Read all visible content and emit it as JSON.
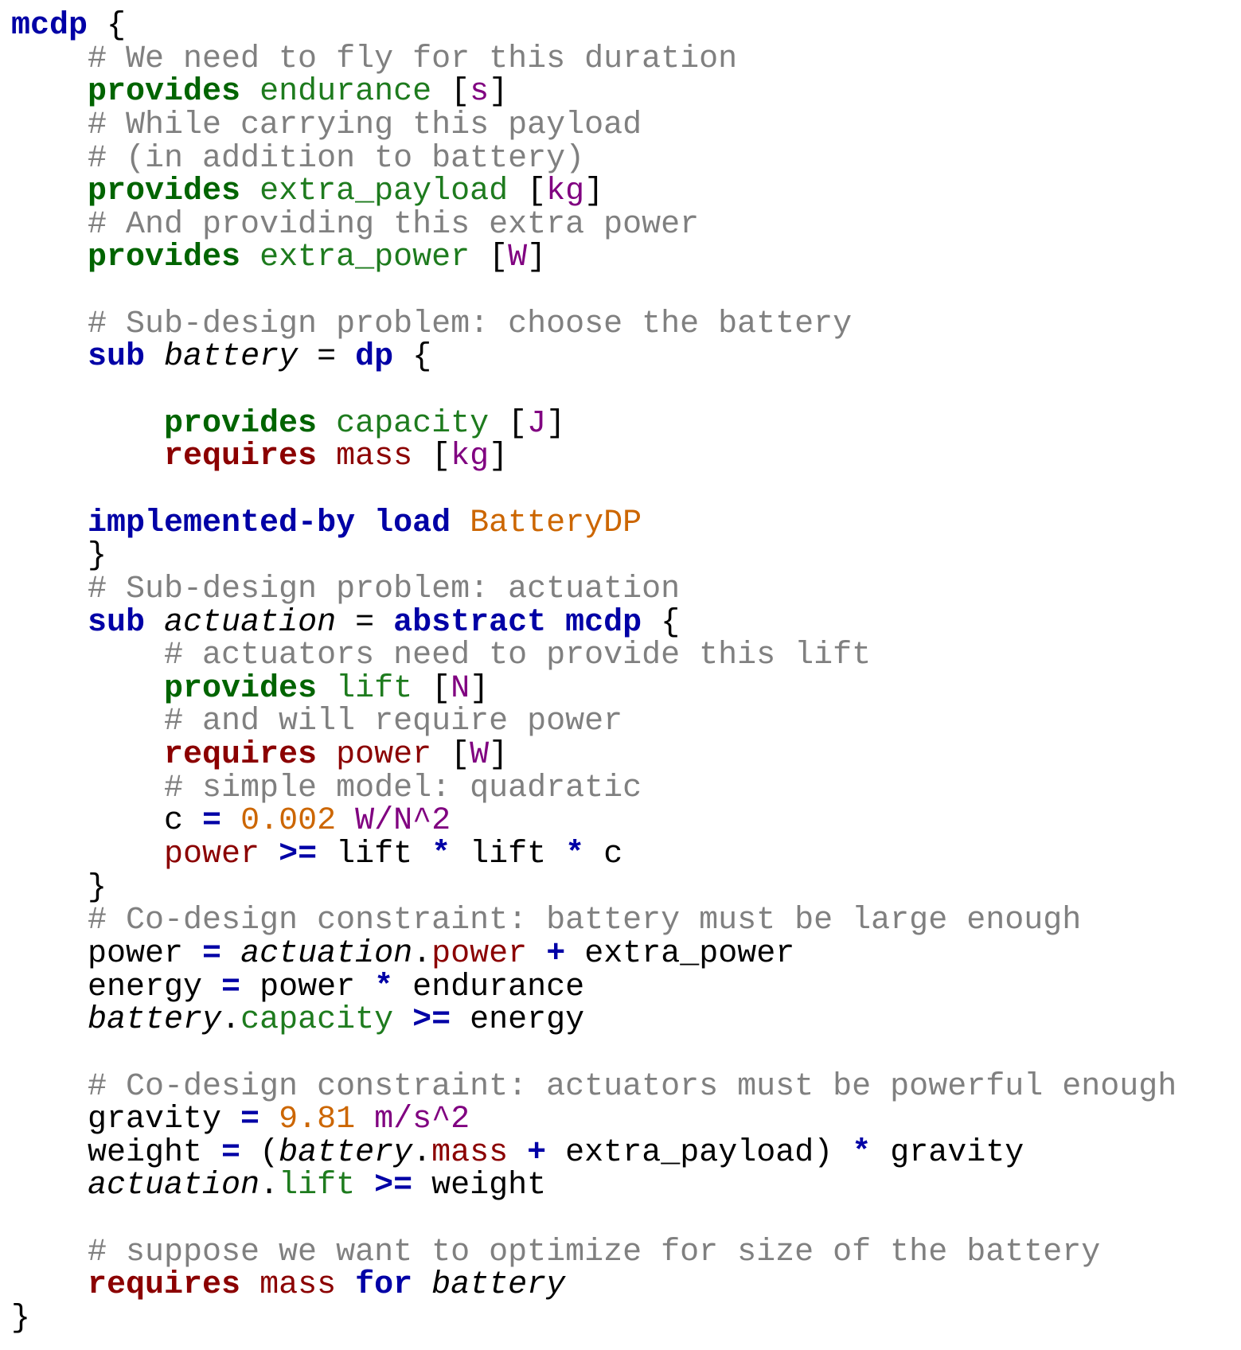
{
  "colors": {
    "keyword_blue": "#0000a6",
    "keyword_green": "#006400",
    "keyword_red": "#8b0000",
    "identifier_green": "#1e7b1e",
    "identifier_red": "#8b0000",
    "unit_purple": "#800080",
    "number_orange": "#cc6600",
    "comment_gray": "#808080",
    "text_black": "#000000"
  },
  "code": {
    "lines": [
      [
        {
          "text": "mcdp",
          "kind": "kw-blue"
        },
        {
          "text": " {",
          "kind": "plain"
        }
      ],
      [
        {
          "text": "    ",
          "kind": "plain"
        },
        {
          "text": "# We need to fly for this duration",
          "kind": "comment"
        }
      ],
      [
        {
          "text": "    ",
          "kind": "plain"
        },
        {
          "text": "provides",
          "kind": "kw-green"
        },
        {
          "text": " ",
          "kind": "plain"
        },
        {
          "text": "endurance",
          "kind": "id-green"
        },
        {
          "text": " [",
          "kind": "plain"
        },
        {
          "text": "s",
          "kind": "unit"
        },
        {
          "text": "]",
          "kind": "plain"
        }
      ],
      [
        {
          "text": "    ",
          "kind": "plain"
        },
        {
          "text": "# While carrying this payload",
          "kind": "comment"
        }
      ],
      [
        {
          "text": "    ",
          "kind": "plain"
        },
        {
          "text": "# (in addition to battery)",
          "kind": "comment"
        }
      ],
      [
        {
          "text": "    ",
          "kind": "plain"
        },
        {
          "text": "provides",
          "kind": "kw-green"
        },
        {
          "text": " ",
          "kind": "plain"
        },
        {
          "text": "extra_payload",
          "kind": "id-green"
        },
        {
          "text": " [",
          "kind": "plain"
        },
        {
          "text": "kg",
          "kind": "unit"
        },
        {
          "text": "]",
          "kind": "plain"
        }
      ],
      [
        {
          "text": "    ",
          "kind": "plain"
        },
        {
          "text": "# And providing this extra power",
          "kind": "comment"
        }
      ],
      [
        {
          "text": "    ",
          "kind": "plain"
        },
        {
          "text": "provides",
          "kind": "kw-green"
        },
        {
          "text": " ",
          "kind": "plain"
        },
        {
          "text": "extra_power",
          "kind": "id-green"
        },
        {
          "text": " [",
          "kind": "plain"
        },
        {
          "text": "W",
          "kind": "unit"
        },
        {
          "text": "]",
          "kind": "plain"
        }
      ],
      [],
      [
        {
          "text": "    ",
          "kind": "plain"
        },
        {
          "text": "# Sub-design problem: choose the battery",
          "kind": "comment"
        }
      ],
      [
        {
          "text": "    ",
          "kind": "plain"
        },
        {
          "text": "sub",
          "kind": "kw-blue"
        },
        {
          "text": " ",
          "kind": "plain"
        },
        {
          "text": "battery",
          "kind": "italic"
        },
        {
          "text": " = ",
          "kind": "plain"
        },
        {
          "text": "dp",
          "kind": "kw-blue"
        },
        {
          "text": " {",
          "kind": "plain"
        }
      ],
      [],
      [
        {
          "text": "        ",
          "kind": "plain"
        },
        {
          "text": "provides",
          "kind": "kw-green"
        },
        {
          "text": " ",
          "kind": "plain"
        },
        {
          "text": "capacity",
          "kind": "id-green"
        },
        {
          "text": " [",
          "kind": "plain"
        },
        {
          "text": "J",
          "kind": "unit"
        },
        {
          "text": "]",
          "kind": "plain"
        }
      ],
      [
        {
          "text": "        ",
          "kind": "plain"
        },
        {
          "text": "requires",
          "kind": "kw-red"
        },
        {
          "text": " ",
          "kind": "plain"
        },
        {
          "text": "mass",
          "kind": "id-red"
        },
        {
          "text": " [",
          "kind": "plain"
        },
        {
          "text": "kg",
          "kind": "unit"
        },
        {
          "text": "]",
          "kind": "plain"
        }
      ],
      [],
      [
        {
          "text": "    ",
          "kind": "plain"
        },
        {
          "text": "implemented-by",
          "kind": "kw-blue"
        },
        {
          "text": " ",
          "kind": "plain"
        },
        {
          "text": "load",
          "kind": "kw-blue"
        },
        {
          "text": " ",
          "kind": "plain"
        },
        {
          "text": "BatteryDP",
          "kind": "number"
        }
      ],
      [
        {
          "text": "    }",
          "kind": "plain"
        }
      ],
      [
        {
          "text": "    ",
          "kind": "plain"
        },
        {
          "text": "# Sub-design problem: actuation",
          "kind": "comment"
        }
      ],
      [
        {
          "text": "    ",
          "kind": "plain"
        },
        {
          "text": "sub",
          "kind": "kw-blue"
        },
        {
          "text": " ",
          "kind": "plain"
        },
        {
          "text": "actuation",
          "kind": "italic"
        },
        {
          "text": " = ",
          "kind": "plain"
        },
        {
          "text": "abstract",
          "kind": "kw-blue"
        },
        {
          "text": " ",
          "kind": "plain"
        },
        {
          "text": "mcdp",
          "kind": "kw-blue"
        },
        {
          "text": " {",
          "kind": "plain"
        }
      ],
      [
        {
          "text": "        ",
          "kind": "plain"
        },
        {
          "text": "# actuators need to provide this lift",
          "kind": "comment"
        }
      ],
      [
        {
          "text": "        ",
          "kind": "plain"
        },
        {
          "text": "provides",
          "kind": "kw-green"
        },
        {
          "text": " ",
          "kind": "plain"
        },
        {
          "text": "lift",
          "kind": "id-green"
        },
        {
          "text": " [",
          "kind": "plain"
        },
        {
          "text": "N",
          "kind": "unit"
        },
        {
          "text": "]",
          "kind": "plain"
        }
      ],
      [
        {
          "text": "        ",
          "kind": "plain"
        },
        {
          "text": "# and will require power",
          "kind": "comment"
        }
      ],
      [
        {
          "text": "        ",
          "kind": "plain"
        },
        {
          "text": "requires",
          "kind": "kw-red"
        },
        {
          "text": " ",
          "kind": "plain"
        },
        {
          "text": "power",
          "kind": "id-red"
        },
        {
          "text": " [",
          "kind": "plain"
        },
        {
          "text": "W",
          "kind": "unit"
        },
        {
          "text": "]",
          "kind": "plain"
        }
      ],
      [
        {
          "text": "        ",
          "kind": "plain"
        },
        {
          "text": "# simple model: quadratic",
          "kind": "comment"
        }
      ],
      [
        {
          "text": "        c ",
          "kind": "plain"
        },
        {
          "text": "=",
          "kind": "op"
        },
        {
          "text": " ",
          "kind": "plain"
        },
        {
          "text": "0.002",
          "kind": "number"
        },
        {
          "text": " ",
          "kind": "plain"
        },
        {
          "text": "W/N^2",
          "kind": "unit"
        }
      ],
      [
        {
          "text": "        ",
          "kind": "plain"
        },
        {
          "text": "power",
          "kind": "id-red"
        },
        {
          "text": " ",
          "kind": "plain"
        },
        {
          "text": ">=",
          "kind": "op"
        },
        {
          "text": " lift ",
          "kind": "plain"
        },
        {
          "text": "*",
          "kind": "op"
        },
        {
          "text": " lift ",
          "kind": "plain"
        },
        {
          "text": "*",
          "kind": "op"
        },
        {
          "text": " c",
          "kind": "plain"
        }
      ],
      [
        {
          "text": "    }",
          "kind": "plain"
        }
      ],
      [
        {
          "text": "    ",
          "kind": "plain"
        },
        {
          "text": "# Co-design constraint: battery must be large enough",
          "kind": "comment"
        }
      ],
      [
        {
          "text": "    power ",
          "kind": "plain"
        },
        {
          "text": "=",
          "kind": "op"
        },
        {
          "text": " ",
          "kind": "plain"
        },
        {
          "text": "actuation",
          "kind": "italic"
        },
        {
          "text": ".",
          "kind": "plain"
        },
        {
          "text": "power",
          "kind": "id-red"
        },
        {
          "text": " ",
          "kind": "plain"
        },
        {
          "text": "+",
          "kind": "op"
        },
        {
          "text": " extra_power",
          "kind": "plain"
        }
      ],
      [
        {
          "text": "    energy ",
          "kind": "plain"
        },
        {
          "text": "=",
          "kind": "op"
        },
        {
          "text": " power ",
          "kind": "plain"
        },
        {
          "text": "*",
          "kind": "op"
        },
        {
          "text": " endurance",
          "kind": "plain"
        }
      ],
      [
        {
          "text": "    ",
          "kind": "plain"
        },
        {
          "text": "battery",
          "kind": "italic"
        },
        {
          "text": ".",
          "kind": "plain"
        },
        {
          "text": "capacity",
          "kind": "id-green"
        },
        {
          "text": " ",
          "kind": "plain"
        },
        {
          "text": ">=",
          "kind": "op"
        },
        {
          "text": " energy",
          "kind": "plain"
        }
      ],
      [],
      [
        {
          "text": "    ",
          "kind": "plain"
        },
        {
          "text": "# Co-design constraint: actuators must be powerful enough",
          "kind": "comment"
        }
      ],
      [
        {
          "text": "    gravity ",
          "kind": "plain"
        },
        {
          "text": "=",
          "kind": "op"
        },
        {
          "text": " ",
          "kind": "plain"
        },
        {
          "text": "9.81",
          "kind": "number"
        },
        {
          "text": " ",
          "kind": "plain"
        },
        {
          "text": "m/s^2",
          "kind": "unit"
        }
      ],
      [
        {
          "text": "    weight ",
          "kind": "plain"
        },
        {
          "text": "=",
          "kind": "op"
        },
        {
          "text": " (",
          "kind": "plain"
        },
        {
          "text": "battery",
          "kind": "italic"
        },
        {
          "text": ".",
          "kind": "plain"
        },
        {
          "text": "mass",
          "kind": "id-red"
        },
        {
          "text": " ",
          "kind": "plain"
        },
        {
          "text": "+",
          "kind": "op"
        },
        {
          "text": " extra_payload) ",
          "kind": "plain"
        },
        {
          "text": "*",
          "kind": "op"
        },
        {
          "text": " gravity",
          "kind": "plain"
        }
      ],
      [
        {
          "text": "    ",
          "kind": "plain"
        },
        {
          "text": "actuation",
          "kind": "italic"
        },
        {
          "text": ".",
          "kind": "plain"
        },
        {
          "text": "lift",
          "kind": "id-green"
        },
        {
          "text": " ",
          "kind": "plain"
        },
        {
          "text": ">=",
          "kind": "op"
        },
        {
          "text": " weight",
          "kind": "plain"
        }
      ],
      [],
      [
        {
          "text": "    ",
          "kind": "plain"
        },
        {
          "text": "# suppose we want to optimize for size of the battery",
          "kind": "comment"
        }
      ],
      [
        {
          "text": "    ",
          "kind": "plain"
        },
        {
          "text": "requires",
          "kind": "kw-red"
        },
        {
          "text": " ",
          "kind": "plain"
        },
        {
          "text": "mass",
          "kind": "id-red"
        },
        {
          "text": " ",
          "kind": "plain"
        },
        {
          "text": "for",
          "kind": "kw-blue"
        },
        {
          "text": " ",
          "kind": "plain"
        },
        {
          "text": "battery",
          "kind": "italic"
        }
      ],
      [
        {
          "text": "}",
          "kind": "plain"
        }
      ]
    ]
  }
}
